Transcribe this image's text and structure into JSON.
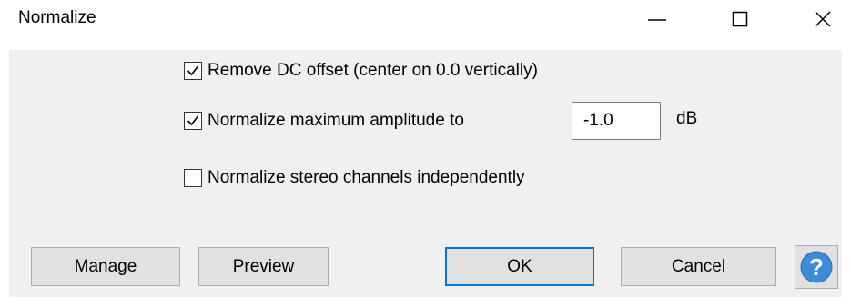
{
  "window": {
    "title": "Normalize"
  },
  "titlebar": {
    "minimize_icon": "minimize-icon",
    "maximize_icon": "maximize-icon",
    "close_icon": "close-icon"
  },
  "options": {
    "remove_dc": {
      "label": "Remove DC offset (center on 0.0 vertically)",
      "checked": true
    },
    "normalize_amplitude": {
      "label": "Normalize maximum amplitude to",
      "checked": true,
      "value": "-1.0",
      "unit": "dB"
    },
    "stereo_independent": {
      "label": "Normalize stereo channels independently",
      "checked": false
    }
  },
  "buttons": {
    "manage": "Manage",
    "preview": "Preview",
    "ok": "OK",
    "cancel": "Cancel",
    "help_icon": "help-icon"
  },
  "colors": {
    "dialog_bg": "#f0f0f0",
    "button_bg": "#e1e1e1",
    "default_button_border": "#0078d7",
    "help_icon_bg": "#3c8bd9"
  }
}
